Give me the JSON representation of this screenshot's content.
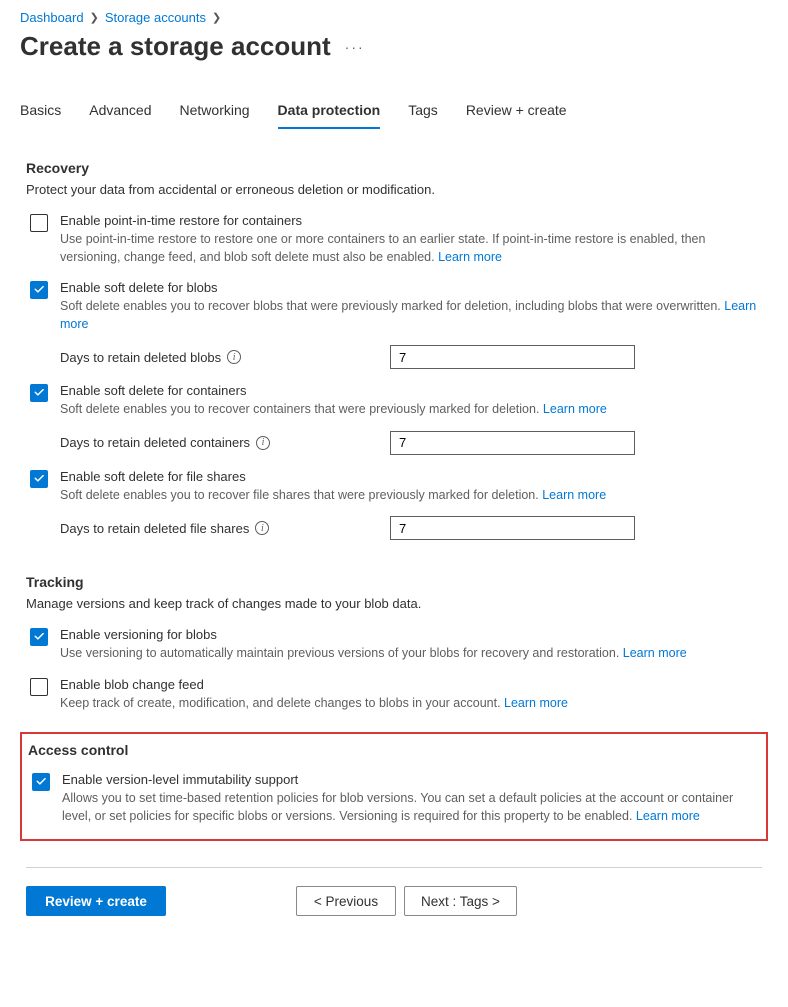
{
  "breadcrumb": {
    "dashboard": "Dashboard",
    "storage": "Storage accounts"
  },
  "title": "Create a storage account",
  "tabs": [
    "Basics",
    "Advanced",
    "Networking",
    "Data protection",
    "Tags",
    "Review + create"
  ],
  "activeTab": "Data protection",
  "recovery": {
    "heading": "Recovery",
    "desc": "Protect your data from accidental or erroneous deletion or modification.",
    "pitr": {
      "label": "Enable point-in-time restore for containers",
      "desc": "Use point-in-time restore to restore one or more containers to an earlier state. If point-in-time restore is enabled, then versioning, change feed, and blob soft delete must also be enabled.",
      "learn": "Learn more"
    },
    "blobSoft": {
      "label": "Enable soft delete for blobs",
      "desc": "Soft delete enables you to recover blobs that were previously marked for deletion, including blobs that were overwritten.",
      "learn": "Learn more",
      "fieldLabel": "Days to retain deleted blobs",
      "fieldValue": "7"
    },
    "containerSoft": {
      "label": "Enable soft delete for containers",
      "desc": "Soft delete enables you to recover containers that were previously marked for deletion.",
      "learn": "Learn more",
      "fieldLabel": "Days to retain deleted containers",
      "fieldValue": "7"
    },
    "shareSoft": {
      "label": "Enable soft delete for file shares",
      "desc": "Soft delete enables you to recover file shares that were previously marked for deletion.",
      "learn": "Learn more",
      "fieldLabel": "Days to retain deleted file shares",
      "fieldValue": "7"
    }
  },
  "tracking": {
    "heading": "Tracking",
    "desc": "Manage versions and keep track of changes made to your blob data.",
    "versioning": {
      "label": "Enable versioning for blobs",
      "desc": "Use versioning to automatically maintain previous versions of your blobs for recovery and restoration.",
      "learn": "Learn more"
    },
    "changeFeed": {
      "label": "Enable blob change feed",
      "desc": "Keep track of create, modification, and delete changes to blobs in your account.",
      "learn": "Learn more"
    }
  },
  "access": {
    "heading": "Access control",
    "immut": {
      "label": "Enable version-level immutability support",
      "desc": "Allows you to set time-based retention policies for blob versions. You can set a default policies at the account or container level, or set policies for specific blobs or versions. Versioning is required for this property to be enabled.",
      "learn": "Learn more"
    }
  },
  "footer": {
    "review": "Review + create",
    "prev": "< Previous",
    "next": "Next : Tags >"
  }
}
